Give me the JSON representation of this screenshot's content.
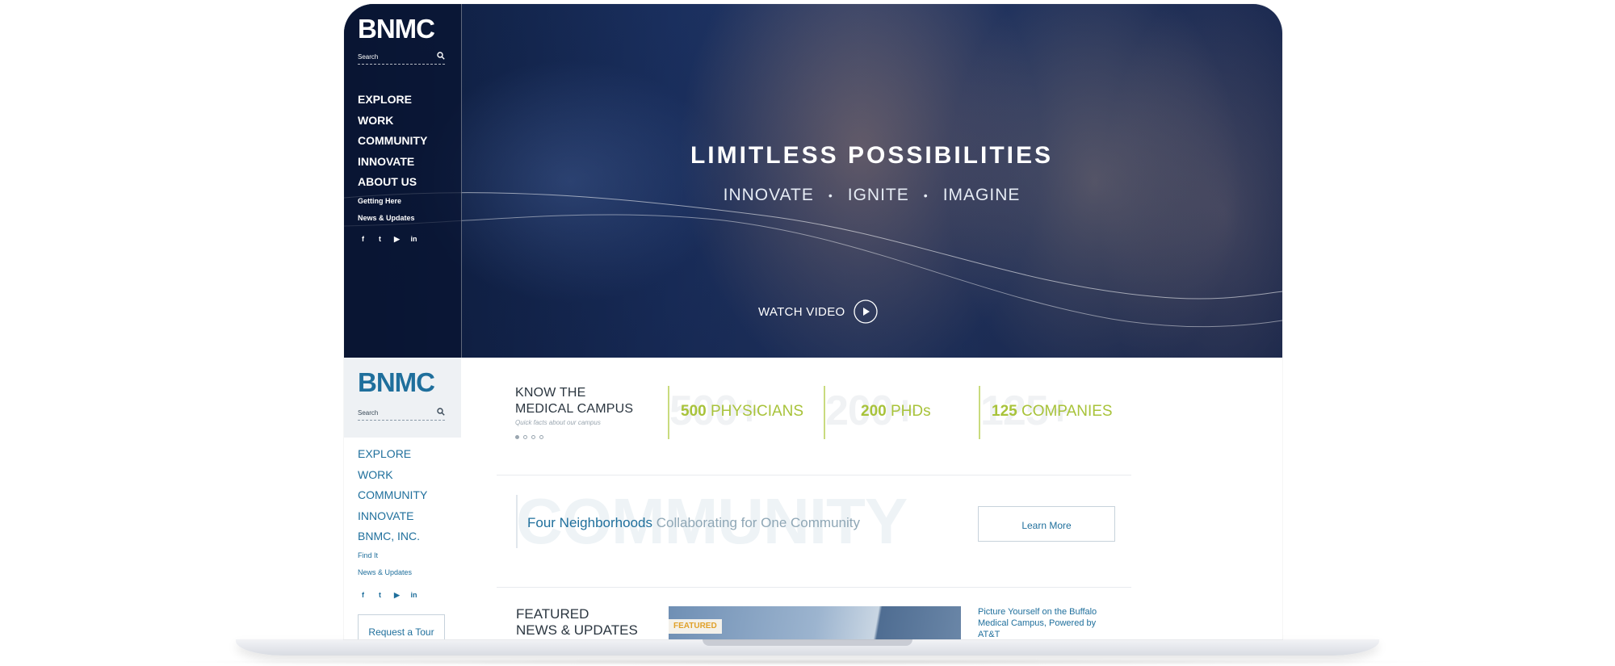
{
  "brand": {
    "logo_text": "BNMC",
    "primary": "#1f6f9c",
    "accent": "#a8c33a",
    "hero_bg": "#1d3466"
  },
  "search": {
    "placeholder": "Search",
    "icon": "search-icon"
  },
  "hero_nav": {
    "items": [
      "EXPLORE",
      "WORK",
      "COMMUNITY",
      "INNOVATE",
      "ABOUT US"
    ],
    "sub_items": [
      "Getting Here",
      "News & Updates"
    ]
  },
  "social": {
    "facebook": "f",
    "twitter": "t",
    "youtube": "▶",
    "linkedin": "in"
  },
  "hero": {
    "title": "LIMITLESS POSSIBILITIES",
    "tagline": [
      "INNOVATE",
      "IGNITE",
      "IMAGINE"
    ],
    "separator": "•",
    "watch_label": "WATCH VIDEO"
  },
  "lower_nav": {
    "items": [
      "EXPLORE",
      "WORK",
      "COMMUNITY",
      "INNOVATE",
      "BNMC, INC."
    ],
    "sub_items": [
      "Find It",
      "News & Updates"
    ],
    "tour_button": "Request a Tour"
  },
  "know": {
    "title_line1": "KNOW THE",
    "title_line2": "MEDICAL CAMPUS",
    "subtitle": "Quick facts about our campus",
    "stats": [
      {
        "ghost": "500+",
        "number": "500",
        "label": "PHYSICIANS"
      },
      {
        "ghost": "200+",
        "number": "200",
        "label": "PHDs"
      },
      {
        "ghost": "125+",
        "number": "125",
        "label": "COMPANIES"
      }
    ]
  },
  "community": {
    "ghost": "COMMUNITY",
    "strong": "Four Neighborhoods",
    "light": "Collaborating for One Community",
    "button": "Learn More"
  },
  "featured": {
    "title_line1": "FEATURED",
    "title_line2": "NEWS & UPDATES",
    "badge": "FEATURED",
    "link": "Picture Yourself on the Buffalo Medical Campus, Powered by AT&T"
  }
}
